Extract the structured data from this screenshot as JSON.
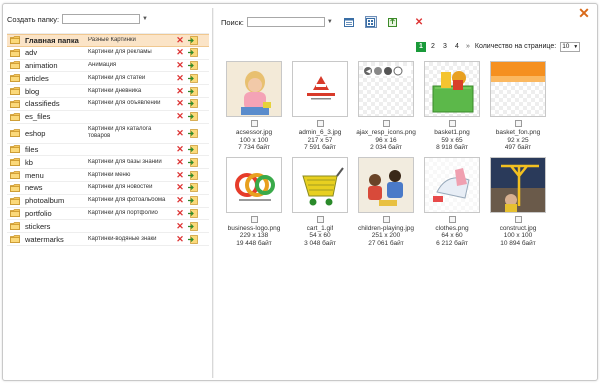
{
  "left": {
    "create_label": "Создать папку:",
    "folders": [
      {
        "name": "Главная папка",
        "desc": "Разные Картинки",
        "selected": true
      },
      {
        "name": "adv",
        "desc": "Картинки для рекламы"
      },
      {
        "name": "animation",
        "desc": "Анимация"
      },
      {
        "name": "articles",
        "desc": "Картинки для статей"
      },
      {
        "name": "blog",
        "desc": "Картинки дневника"
      },
      {
        "name": "classifieds",
        "desc": "Картинки для объявлений"
      },
      {
        "name": "es_files",
        "desc": ""
      },
      {
        "name": "eshop",
        "desc": "Картинки для каталога товаров",
        "tall": true
      },
      {
        "name": "files",
        "desc": ""
      },
      {
        "name": "kb",
        "desc": "Картинки для базы знаний"
      },
      {
        "name": "menu",
        "desc": "Картинки меню"
      },
      {
        "name": "news",
        "desc": "Картинки для новостей"
      },
      {
        "name": "photoalbum",
        "desc": "Картинки для фотоальбома"
      },
      {
        "name": "portfolio",
        "desc": "Картинки для портфолио"
      },
      {
        "name": "stickers",
        "desc": ""
      },
      {
        "name": "watermarks",
        "desc": "Картинки-водяные знаки"
      }
    ]
  },
  "toolbar": {
    "search_label": "Поиск:",
    "icons": [
      "list-view-icon",
      "thumbnail-view-icon",
      "upload-icon",
      "delete-icon"
    ]
  },
  "pager": {
    "pages": [
      "1",
      "2",
      "3",
      "4"
    ],
    "current": "1",
    "next": "»",
    "per_page_label": "Количество на странице:",
    "per_page_value": "10"
  },
  "files": [
    {
      "name": "acsessor.jpg",
      "dims": "100 x 100",
      "size": "7 734 байт",
      "art": "girl"
    },
    {
      "name": "admin_6_3.jpg",
      "dims": "217 x 57",
      "size": "7 591 байт",
      "art": "logo"
    },
    {
      "name": "ajax_resp_icons.png",
      "dims": "96 x 16",
      "size": "2 034 байт",
      "art": "icons"
    },
    {
      "name": "basket1.png",
      "dims": "59 x 65",
      "size": "8 918 байт",
      "art": "basket"
    },
    {
      "name": "basket_fon.png",
      "dims": "92 x 25",
      "size": "497 байт",
      "art": "orange"
    },
    {
      "name": "business-logo.png",
      "dims": "229 x 138",
      "size": "19 448 байт",
      "art": "circles"
    },
    {
      "name": "cart_1.gif",
      "dims": "54 x 60",
      "size": "3 048 байт",
      "art": "cart"
    },
    {
      "name": "children-playing.jpg",
      "dims": "251 x 200",
      "size": "27 061 байт",
      "art": "kids"
    },
    {
      "name": "clothes.png",
      "dims": "64 x 60",
      "size": "6 212 байт",
      "art": "clothes"
    },
    {
      "name": "construct.jpg",
      "dims": "100 x 100",
      "size": "10 894 байт",
      "art": "crane"
    }
  ],
  "colors": {
    "accent": "#1a9a3a",
    "selected_row": "#fbe4c7",
    "close": "#d96a1a",
    "delete": "#dd3333"
  }
}
